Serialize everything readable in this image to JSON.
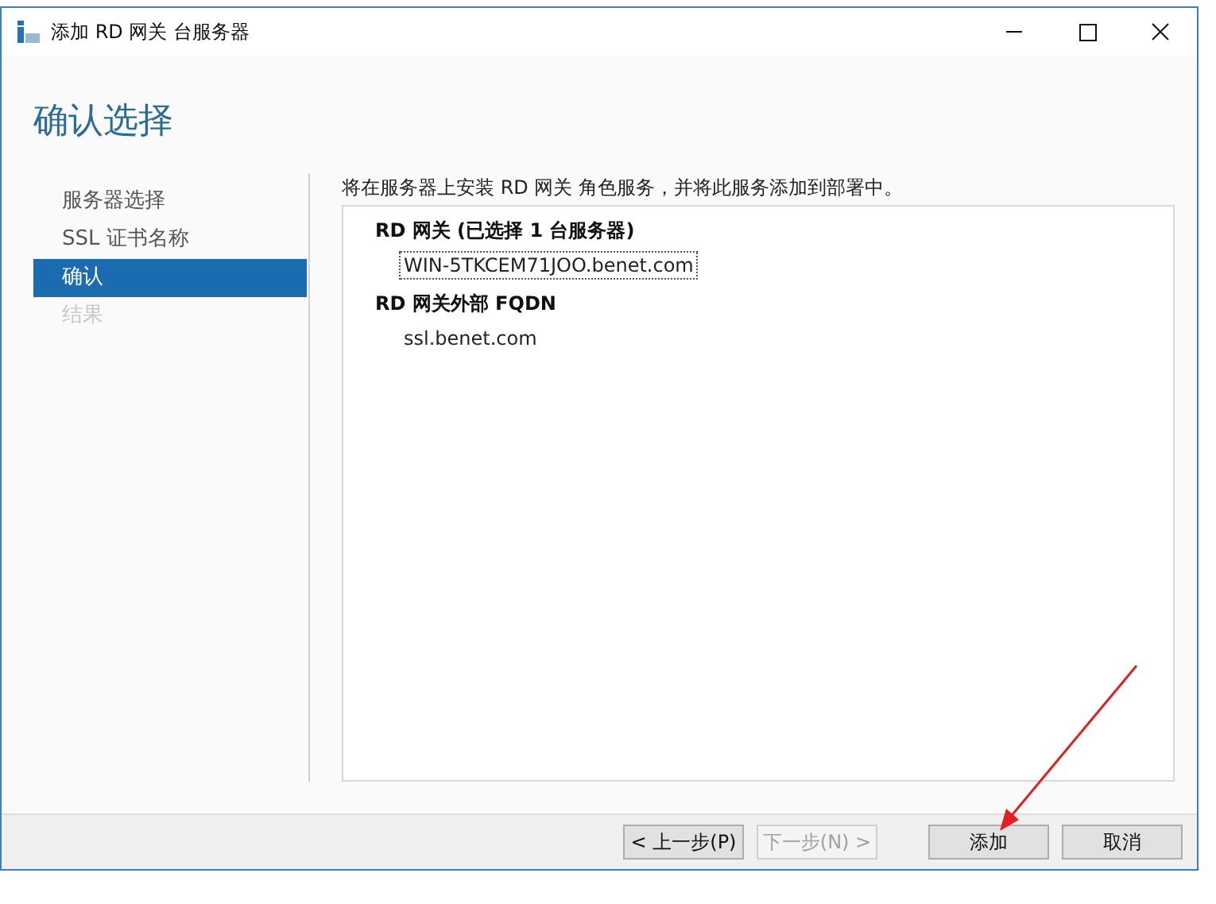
{
  "window": {
    "title": "添加 RD 网关 台服务器"
  },
  "page_title": "确认选择",
  "sidebar": {
    "items": [
      {
        "label": "服务器选择",
        "selected": false,
        "disabled": false
      },
      {
        "label": "SSL 证书名称",
        "selected": false,
        "disabled": false
      },
      {
        "label": "确认",
        "selected": true,
        "disabled": false
      },
      {
        "label": "结果",
        "selected": false,
        "disabled": true
      }
    ]
  },
  "description": "将在服务器上安装 RD 网关 角色服务，并将此服务添加到部署中。",
  "summary": [
    {
      "heading": "RD 网关  (已选择 1 台服务器)",
      "value": "WIN-5TKCEM71JOO.benet.com",
      "focused": true
    },
    {
      "heading": "RD 网关外部 FQDN",
      "value": "ssl.benet.com",
      "focused": false
    }
  ],
  "buttons": [
    {
      "label": "< 上一步(P)",
      "disabled": false
    },
    {
      "label": "下一步(N) >",
      "disabled": true
    },
    {
      "label": "添加",
      "disabled": false
    },
    {
      "label": "取消",
      "disabled": false
    }
  ]
}
